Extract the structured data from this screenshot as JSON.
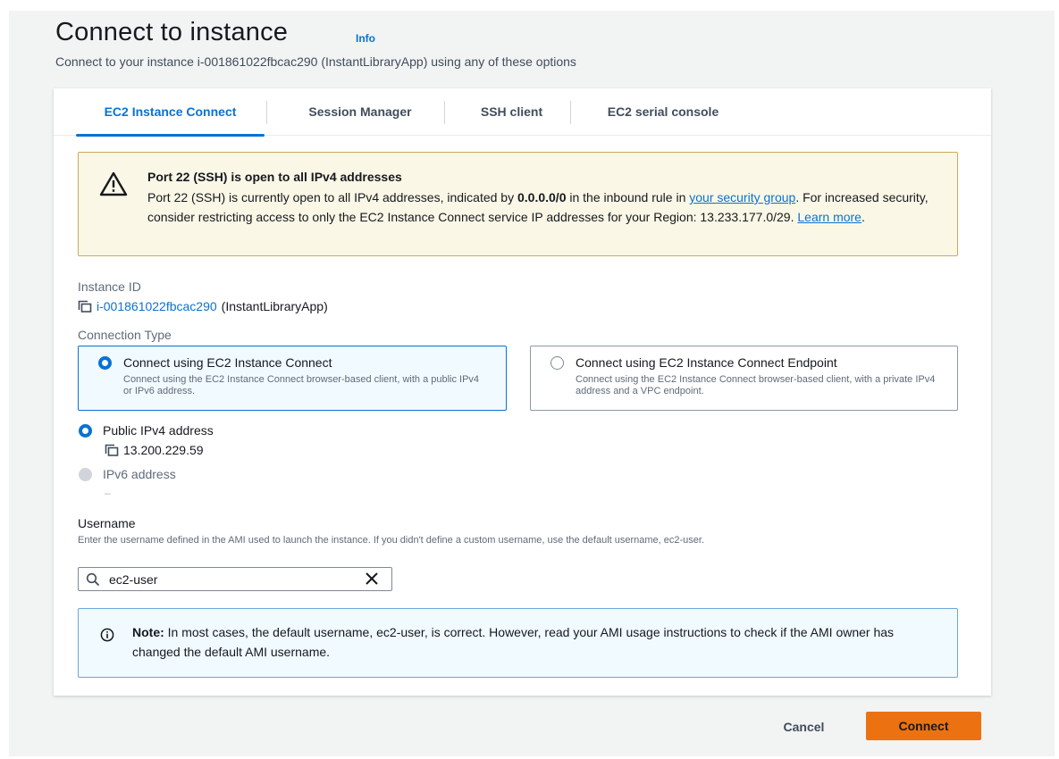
{
  "header": {
    "title": "Connect to instance",
    "info_link": "Info",
    "subtitle": "Connect to your instance i-001861022fbcac290 (InstantLibraryApp) using any of these options"
  },
  "tabs": [
    {
      "label": "EC2 Instance Connect",
      "active": true
    },
    {
      "label": "Session Manager",
      "active": false
    },
    {
      "label": "SSH client",
      "active": false
    },
    {
      "label": "EC2 serial console",
      "active": false
    }
  ],
  "warning": {
    "title": "Port 22 (SSH) is open to all IPv4 addresses",
    "body_1": "Port 22 (SSH) is currently open to all IPv4 addresses, indicated by ",
    "cidr": "0.0.0.0/0",
    "body_2": " in the inbound rule in ",
    "link_security_group": "your security group",
    "body_3": ". For increased security, consider restricting access to only the EC2 Instance Connect service IP addresses for your Region: 13.233.177.0/29. ",
    "link_learn_more": "Learn more",
    "body_4": "."
  },
  "instance": {
    "label": "Instance ID",
    "id": "i-001861022fbcac290",
    "name": "(InstantLibraryApp)"
  },
  "connection_type": {
    "label": "Connection Type",
    "options": [
      {
        "title": "Connect using EC2 Instance Connect",
        "desc": "Connect using the EC2 Instance Connect browser-based client, with a public IPv4 or IPv6 address.",
        "selected": true
      },
      {
        "title": "Connect using EC2 Instance Connect Endpoint",
        "desc": "Connect using the EC2 Instance Connect browser-based client, with a private IPv4 address and a VPC endpoint.",
        "selected": false
      }
    ]
  },
  "address": {
    "public_ipv4_label": "Public IPv4 address",
    "public_ipv4_value": "13.200.229.59",
    "ipv6_label": "IPv6 address",
    "ipv6_value": "–"
  },
  "username": {
    "label": "Username",
    "desc": "Enter the username defined in the AMI used to launch the instance. If you didn't define a custom username, use the default username, ec2-user.",
    "value": "ec2-user"
  },
  "note": {
    "label": "Note:",
    "text": " In most cases, the default username, ec2-user, is correct. However, read your AMI usage instructions to check if the AMI owner has changed the default AMI username."
  },
  "actions": {
    "cancel": "Cancel",
    "connect": "Connect"
  },
  "colors": {
    "accent": "#0972d3",
    "primary_button": "#ec7211",
    "warning_bg": "#fbf7e6",
    "info_bg": "#f1faff"
  }
}
